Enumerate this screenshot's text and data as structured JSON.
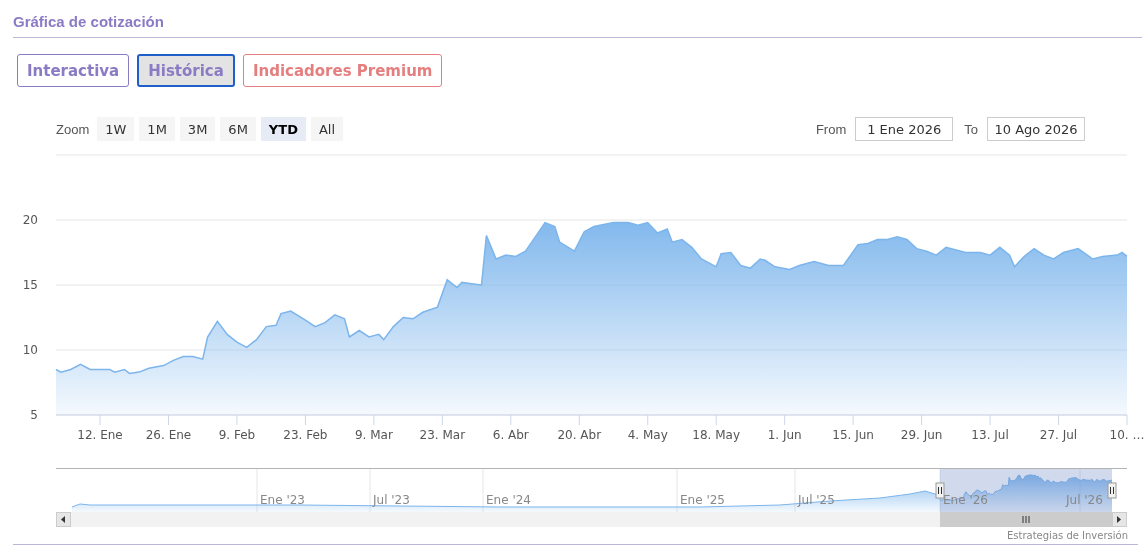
{
  "section_title": "Gráfica de cotización",
  "tabs": [
    {
      "label": "Interactiva",
      "selected": false,
      "color": "#8a7bc4"
    },
    {
      "label": "Histórica",
      "selected": true,
      "color": "#8a7bc4"
    },
    {
      "label": "Indicadores Premium",
      "selected": false,
      "color": "#e57f7f"
    }
  ],
  "zoom": {
    "label": "Zoom",
    "buttons": [
      {
        "label": "1W",
        "selected": false
      },
      {
        "label": "1M",
        "selected": false
      },
      {
        "label": "3M",
        "selected": false
      },
      {
        "label": "6M",
        "selected": false
      },
      {
        "label": "YTD",
        "selected": true
      },
      {
        "label": "All",
        "selected": false
      }
    ]
  },
  "range": {
    "from_label": "From",
    "from": "1 Ene 2026",
    "to_label": "To",
    "to": "10 Ago 2026"
  },
  "chart_data": {
    "type": "area",
    "xlim": [
      "2026-01-03",
      "2026-08-10"
    ],
    "ylim": [
      5,
      25
    ],
    "grid": true,
    "yticks": [
      5,
      10,
      15,
      20
    ],
    "xticks": [
      {
        "value": "2026-01-12",
        "label": "12. Ene"
      },
      {
        "value": "2026-01-26",
        "label": "26. Ene"
      },
      {
        "value": "2026-02-09",
        "label": "9. Feb"
      },
      {
        "value": "2026-02-23",
        "label": "23. Feb"
      },
      {
        "value": "2026-03-09",
        "label": "9. Mar"
      },
      {
        "value": "2026-03-23",
        "label": "23. Mar"
      },
      {
        "value": "2026-04-06",
        "label": "6. Abr"
      },
      {
        "value": "2026-04-20",
        "label": "20. Abr"
      },
      {
        "value": "2026-05-04",
        "label": "4. May"
      },
      {
        "value": "2026-05-18",
        "label": "18. May"
      },
      {
        "value": "2026-06-01",
        "label": "1. Jun"
      },
      {
        "value": "2026-06-15",
        "label": "15. Jun"
      },
      {
        "value": "2026-06-29",
        "label": "29. Jun"
      },
      {
        "value": "2026-07-13",
        "label": "13. Jul"
      },
      {
        "value": "2026-07-27",
        "label": "27. Jul"
      },
      {
        "value": "2026-08-10",
        "label": "10. …"
      }
    ],
    "x": [
      "2026-01-03",
      "2026-01-04",
      "2026-01-06",
      "2026-01-08",
      "2026-01-10",
      "2026-01-14",
      "2026-01-15",
      "2026-01-17",
      "2026-01-18",
      "2026-01-20",
      "2026-01-22",
      "2026-01-25",
      "2026-01-27",
      "2026-01-29",
      "2026-01-31",
      "2026-02-02",
      "2026-02-03",
      "2026-02-05",
      "2026-02-07",
      "2026-02-09",
      "2026-02-11",
      "2026-02-13",
      "2026-02-15",
      "2026-02-17",
      "2026-02-18",
      "2026-02-20",
      "2026-02-23",
      "2026-02-25",
      "2026-02-27",
      "2026-03-01",
      "2026-03-03",
      "2026-03-04",
      "2026-03-06",
      "2026-03-08",
      "2026-03-10",
      "2026-03-11",
      "2026-03-13",
      "2026-03-15",
      "2026-03-17",
      "2026-03-19",
      "2026-03-22",
      "2026-03-24",
      "2026-03-26",
      "2026-03-27",
      "2026-03-29",
      "2026-03-31",
      "2026-04-01",
      "2026-04-03",
      "2026-04-05",
      "2026-04-07",
      "2026-04-09",
      "2026-04-11",
      "2026-04-13",
      "2026-04-15",
      "2026-04-16",
      "2026-04-19",
      "2026-04-21",
      "2026-04-23",
      "2026-04-27",
      "2026-04-30",
      "2026-05-02",
      "2026-05-04",
      "2026-05-06",
      "2026-05-08",
      "2026-05-09",
      "2026-05-11",
      "2026-05-13",
      "2026-05-15",
      "2026-05-18",
      "2026-05-19",
      "2026-05-21",
      "2026-05-23",
      "2026-05-25",
      "2026-05-27",
      "2026-05-28",
      "2026-05-30",
      "2026-06-02",
      "2026-06-04",
      "2026-06-07",
      "2026-06-10",
      "2026-06-13",
      "2026-06-16",
      "2026-06-18",
      "2026-06-20",
      "2026-06-22",
      "2026-06-24",
      "2026-06-26",
      "2026-06-28",
      "2026-06-30",
      "2026-07-02",
      "2026-07-04",
      "2026-07-08",
      "2026-07-11",
      "2026-07-13",
      "2026-07-15",
      "2026-07-17",
      "2026-07-18",
      "2026-07-20",
      "2026-07-22",
      "2026-07-24",
      "2026-07-26",
      "2026-07-28",
      "2026-07-31",
      "2026-08-03",
      "2026-08-05",
      "2026-08-08",
      "2026-08-09",
      "2026-08-10"
    ],
    "series": [
      {
        "color": "#7cb5ec",
        "values": [
          8.5,
          8.3,
          8.5,
          8.9,
          8.5,
          8.5,
          8.3,
          8.5,
          8.2,
          8.3,
          8.6,
          8.8,
          9.2,
          9.5,
          9.5,
          9.3,
          11.0,
          12.2,
          11.2,
          10.6,
          10.2,
          10.8,
          11.8,
          11.9,
          12.8,
          13.0,
          12.3,
          11.8,
          12.1,
          12.7,
          12.4,
          11.0,
          11.5,
          11.0,
          11.2,
          10.8,
          11.8,
          12.5,
          12.4,
          12.9,
          13.3,
          15.4,
          14.8,
          15.2,
          15.1,
          15.0,
          18.8,
          17.0,
          17.3,
          17.2,
          17.6,
          18.7,
          19.8,
          19.5,
          18.3,
          17.6,
          19.1,
          19.5,
          19.8,
          19.8,
          19.6,
          19.8,
          19.0,
          19.3,
          18.3,
          18.5,
          17.9,
          17.0,
          16.4,
          17.4,
          17.5,
          16.5,
          16.3,
          17.0,
          16.9,
          16.4,
          16.2,
          16.5,
          16.8,
          16.5,
          16.5,
          18.1,
          18.2,
          18.5,
          18.5,
          18.7,
          18.5,
          17.8,
          17.6,
          17.3,
          17.9,
          17.5,
          17.5,
          17.3,
          17.9,
          17.3,
          16.4,
          17.2,
          17.8,
          17.3,
          17.0,
          17.5,
          17.8,
          17.0,
          17.2,
          17.3,
          17.5,
          17.2
        ]
      }
    ]
  },
  "navigator": {
    "labels": [
      "Ene '23",
      "Jul '23",
      "Ene '24",
      "Ene '25",
      "Jul '25",
      "Ene '26",
      "Jul '26"
    ]
  },
  "credit": "Estrategias de Inversión"
}
